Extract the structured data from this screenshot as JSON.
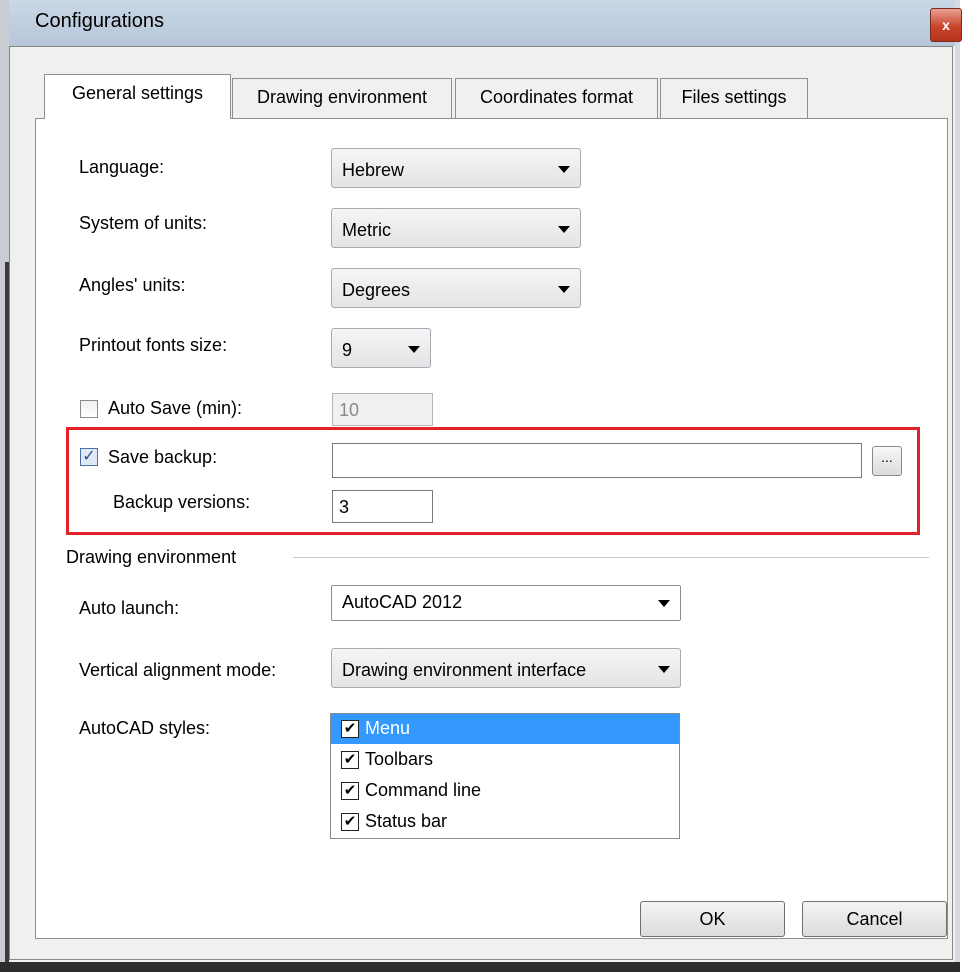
{
  "window": {
    "title": "Configurations",
    "close_glyph": "x"
  },
  "tabs": [
    {
      "label": "General settings",
      "active": true
    },
    {
      "label": "Drawing environment",
      "active": false
    },
    {
      "label": "Coordinates format",
      "active": false
    },
    {
      "label": "Files settings",
      "active": false
    }
  ],
  "general": {
    "language": {
      "label": "Language:",
      "value": "Hebrew"
    },
    "units": {
      "label": "System of units:",
      "value": "Metric"
    },
    "angles": {
      "label": "Angles' units:",
      "value": "Degrees"
    },
    "fontsize": {
      "label": "Printout fonts size:",
      "value": "9"
    },
    "autosave": {
      "label": "Auto Save (min):",
      "checked": false,
      "value": "10"
    },
    "backup": {
      "label": "Save backup:",
      "checked": true,
      "path": "",
      "browse_label": "..."
    },
    "versions": {
      "label": "Backup versions:",
      "value": "3"
    }
  },
  "drawing": {
    "group_label": "Drawing environment",
    "autolaunch": {
      "label": "Auto launch:",
      "value": "AutoCAD 2012"
    },
    "valign": {
      "label": "Vertical alignment mode:",
      "value": "Drawing environment interface"
    },
    "styles_label": "AutoCAD styles:",
    "styles": [
      {
        "label": "Menu",
        "checked": true,
        "selected": true
      },
      {
        "label": "Toolbars",
        "checked": true,
        "selected": false
      },
      {
        "label": "Command line",
        "checked": true,
        "selected": false
      },
      {
        "label": "Status bar",
        "checked": true,
        "selected": false
      }
    ]
  },
  "buttons": {
    "ok": "OK",
    "cancel": "Cancel"
  },
  "colors": {
    "highlight": "#e2222a",
    "selection": "#3399ff",
    "checkbox": "#2b4f8e"
  }
}
